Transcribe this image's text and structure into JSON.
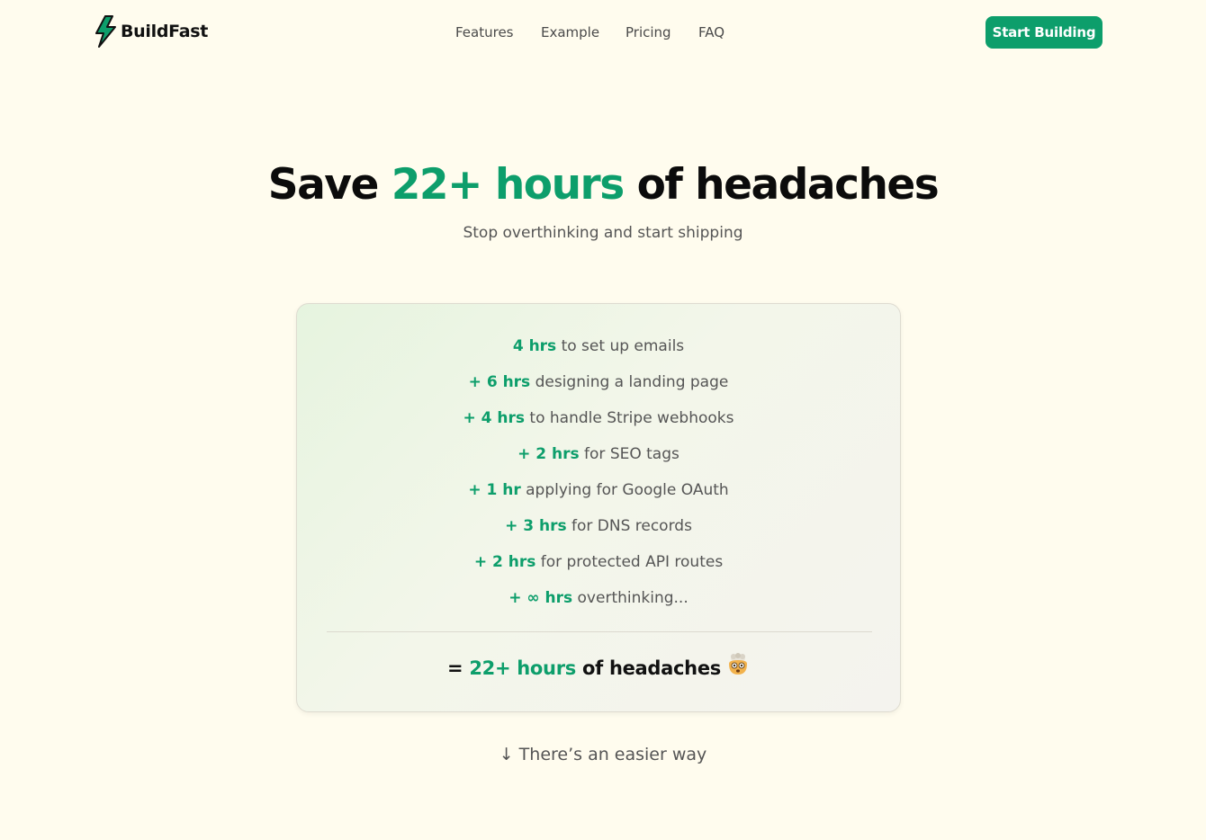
{
  "header": {
    "brand": "BuildFast",
    "nav": [
      "Features",
      "Example",
      "Pricing",
      "FAQ"
    ],
    "cta_label": "Start Building"
  },
  "hero": {
    "title_prefix": "Save ",
    "title_accent": "22+ hours",
    "title_suffix": " of headaches",
    "subtitle": "Stop overthinking and start shipping"
  },
  "card": {
    "items": [
      {
        "hrs": "4 hrs",
        "text": " to set up emails"
      },
      {
        "hrs": "+ 6 hrs",
        "text": " designing a landing page"
      },
      {
        "hrs": "+ 4 hrs",
        "text": " to handle Stripe webhooks"
      },
      {
        "hrs": "+ 2 hrs",
        "text": " for SEO tags"
      },
      {
        "hrs": "+ 1 hr",
        "text": " applying for Google OAuth"
      },
      {
        "hrs": "+ 3 hrs",
        "text": " for DNS records"
      },
      {
        "hrs": "+ 2 hrs",
        "text": " for protected API routes"
      },
      {
        "hrs": "+ ∞ hrs",
        "text": " overthinking..."
      }
    ],
    "total_prefix": "= ",
    "total_accent": "22+ hours",
    "total_suffix": " of headaches",
    "total_emoji": "exploding-head-emoji"
  },
  "footer_hint": "↓ There’s an easier way",
  "colors": {
    "accent": "#0d9e6b",
    "background": "#fffcee"
  }
}
